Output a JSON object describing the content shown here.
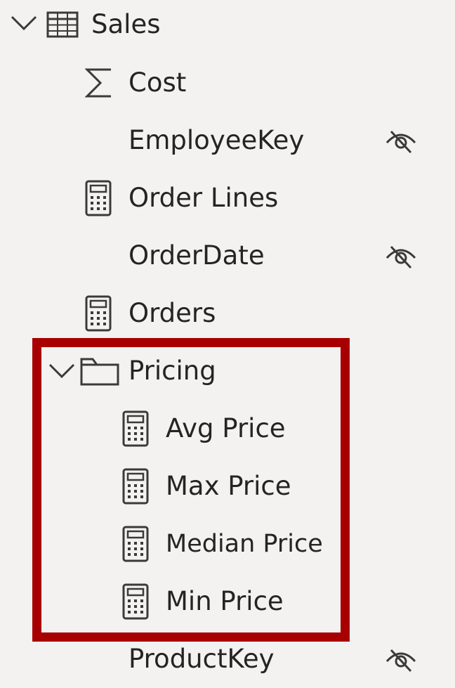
{
  "table": {
    "name": "Sales",
    "icon": "table-icon",
    "expanded": true
  },
  "fields": [
    {
      "label": "Cost",
      "icon": "sigma-icon",
      "hidden": false
    },
    {
      "label": "EmployeeKey",
      "icon": "",
      "hidden": true
    },
    {
      "label": "Order Lines",
      "icon": "calculator-icon",
      "hidden": false
    },
    {
      "label": "OrderDate",
      "icon": "",
      "hidden": true
    },
    {
      "label": "Orders",
      "icon": "calculator-icon",
      "hidden": false
    }
  ],
  "folder": {
    "name": "Pricing",
    "icon": "folder-icon",
    "expanded": true,
    "items": [
      {
        "label": "Avg Price",
        "icon": "calculator-icon"
      },
      {
        "label": "Max Price",
        "icon": "calculator-icon"
      },
      {
        "label": "Median Price",
        "icon": "calculator-icon"
      },
      {
        "label": "Min Price",
        "icon": "calculator-icon"
      }
    ]
  },
  "trailing_fields": [
    {
      "label": "ProductKey",
      "icon": "",
      "hidden": true
    }
  ],
  "colors": {
    "background": "#f3f2f1",
    "text": "#252423",
    "icon": "#3b3a39",
    "highlight": "#a80000"
  }
}
